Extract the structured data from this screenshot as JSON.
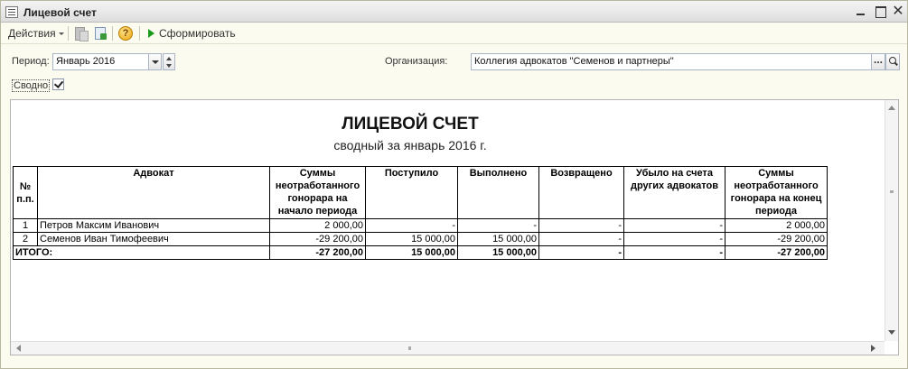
{
  "window": {
    "title": "Лицевой счет"
  },
  "toolbar": {
    "actions_label": "Действия",
    "help_label": "?",
    "generate_label": "Сформировать"
  },
  "filters": {
    "period_label": "Период:",
    "period_value": "Январь 2016",
    "organization_label": "Организация:",
    "organization_value": "Коллегия адвокатов \"Семенов и партнеры\"",
    "organization_dots": "...",
    "svodno_label": "Сводно",
    "svodno_checked": true
  },
  "report": {
    "title": "ЛИЦЕВОЙ СЧЕТ",
    "subtitle": "сводный за январь 2016 г.",
    "columns": [
      "№ п.п.",
      "Адвокат",
      "Суммы неотработанного гонорара на начало периода",
      "Поступило",
      "Выполнено",
      "Возвращено",
      "Убыло на счета других адвокатов",
      "Суммы неотработанного гонорара на конец периода"
    ],
    "rows": [
      [
        "1",
        "Петров Максим Иванович",
        "2 000,00",
        "-",
        "-",
        "-",
        "-",
        "2 000,00"
      ],
      [
        "2",
        "Семенов Иван Тимофеевич",
        "-29 200,00",
        "15 000,00",
        "15 000,00",
        "-",
        "-",
        "-29 200,00"
      ]
    ],
    "total": [
      "ИТОГО:",
      "-27 200,00",
      "15 000,00",
      "15 000,00",
      "-",
      "-",
      "-27 200,00"
    ]
  }
}
